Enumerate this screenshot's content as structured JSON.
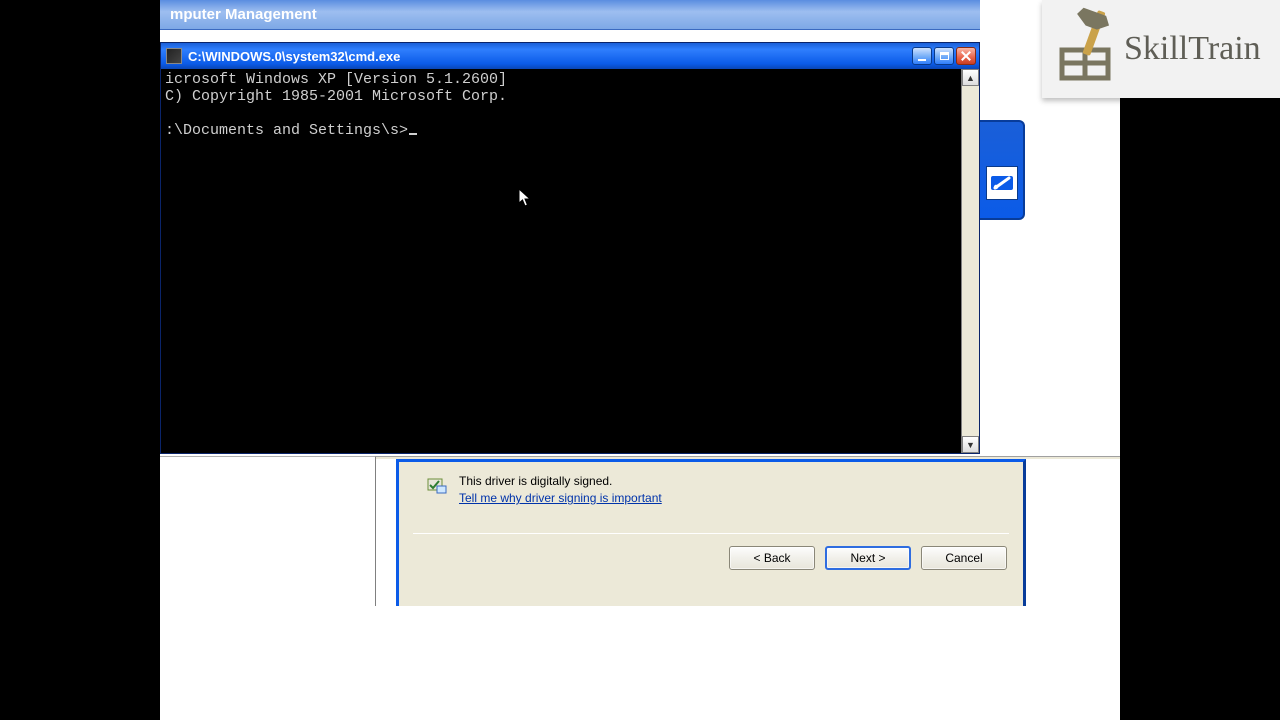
{
  "background_window": {
    "title": "mputer Management"
  },
  "cmd_window": {
    "title": "C:\\WINDOWS.0\\system32\\cmd.exe",
    "line1": "icrosoft Windows XP [Version 5.1.2600]",
    "line2": "C) Copyright 1985-2001 Microsoft Corp.",
    "prompt": ":\\Documents and Settings\\s>"
  },
  "wizard": {
    "signed_text": "This driver is digitally signed.",
    "link_text": "Tell me why driver signing is important",
    "buttons": {
      "back": "< Back",
      "next": "Next >",
      "cancel": "Cancel"
    }
  },
  "logo": {
    "text": "SkillTrain"
  }
}
